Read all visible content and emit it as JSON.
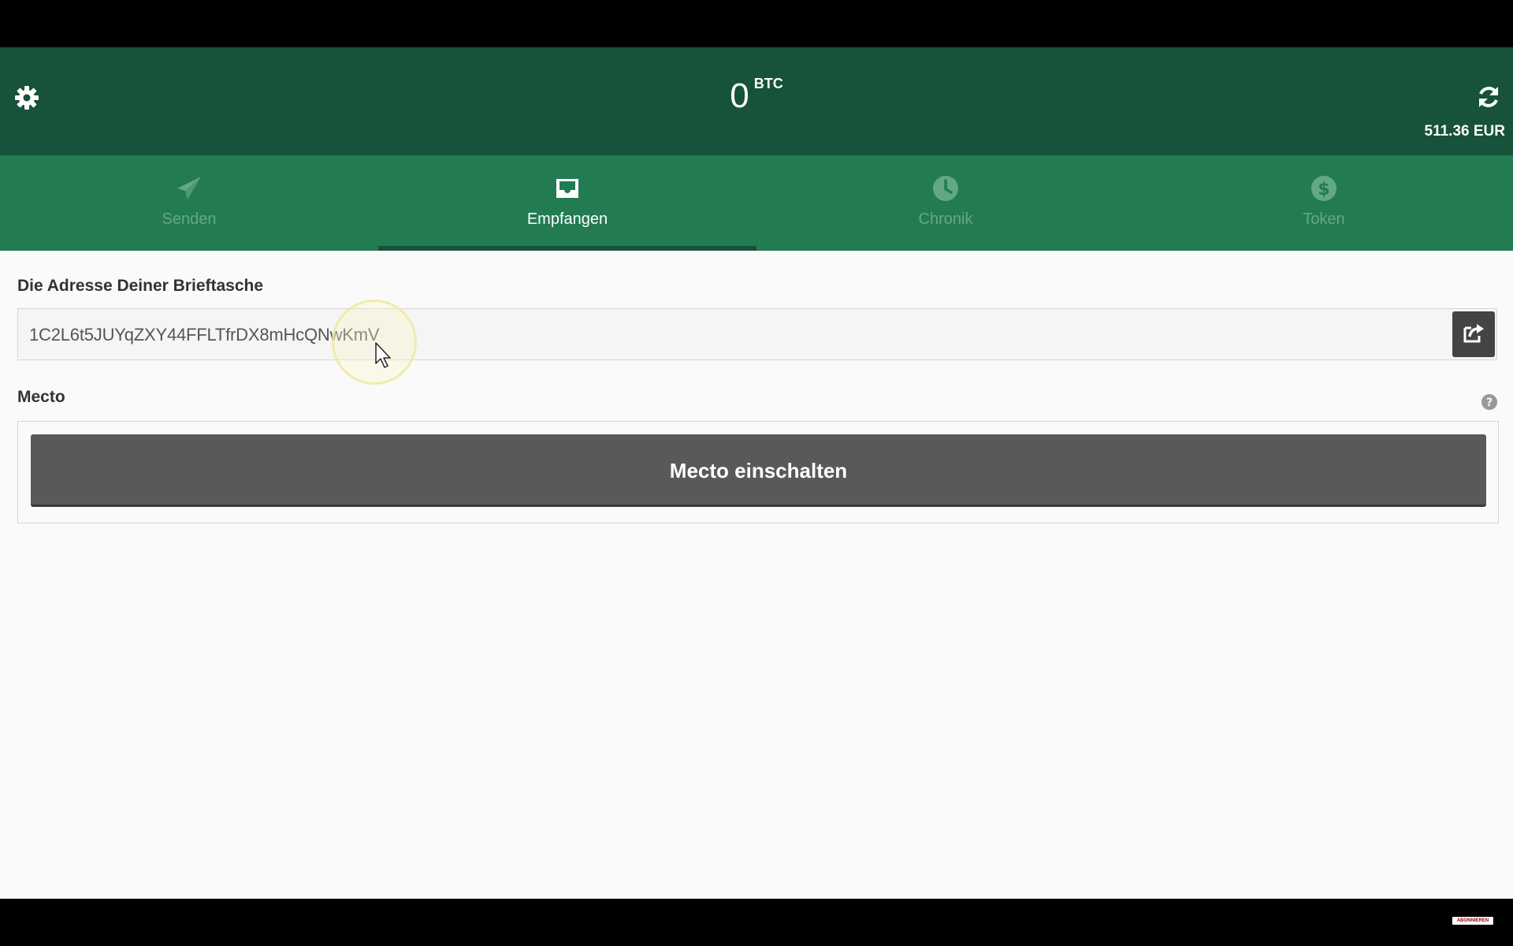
{
  "header": {
    "balance_amount": "0",
    "balance_unit": "BTC",
    "fiat_value": "511.36 EUR"
  },
  "tabs": [
    {
      "label": "Senden",
      "icon": "paper-plane-icon",
      "active": false
    },
    {
      "label": "Empfangen",
      "icon": "inbox-icon",
      "active": true
    },
    {
      "label": "Chronik",
      "icon": "clock-icon",
      "active": false
    },
    {
      "label": "Token",
      "icon": "dollar-circle-icon",
      "active": false
    }
  ],
  "receive": {
    "address_label": "Die Adresse Deiner Brieftasche",
    "address": "1C2L6t5JUYqZXY44FFLTfrDX8mHcQNwKmV",
    "mecto_label": "Mecto",
    "mecto_button": "Mecto einschalten"
  },
  "colors": {
    "header_bg": "#17523a",
    "tabs_bg": "#237b52",
    "inactive_tab": "#62a983",
    "button_bg": "#595959"
  },
  "watermark": "ABONNIEREN"
}
